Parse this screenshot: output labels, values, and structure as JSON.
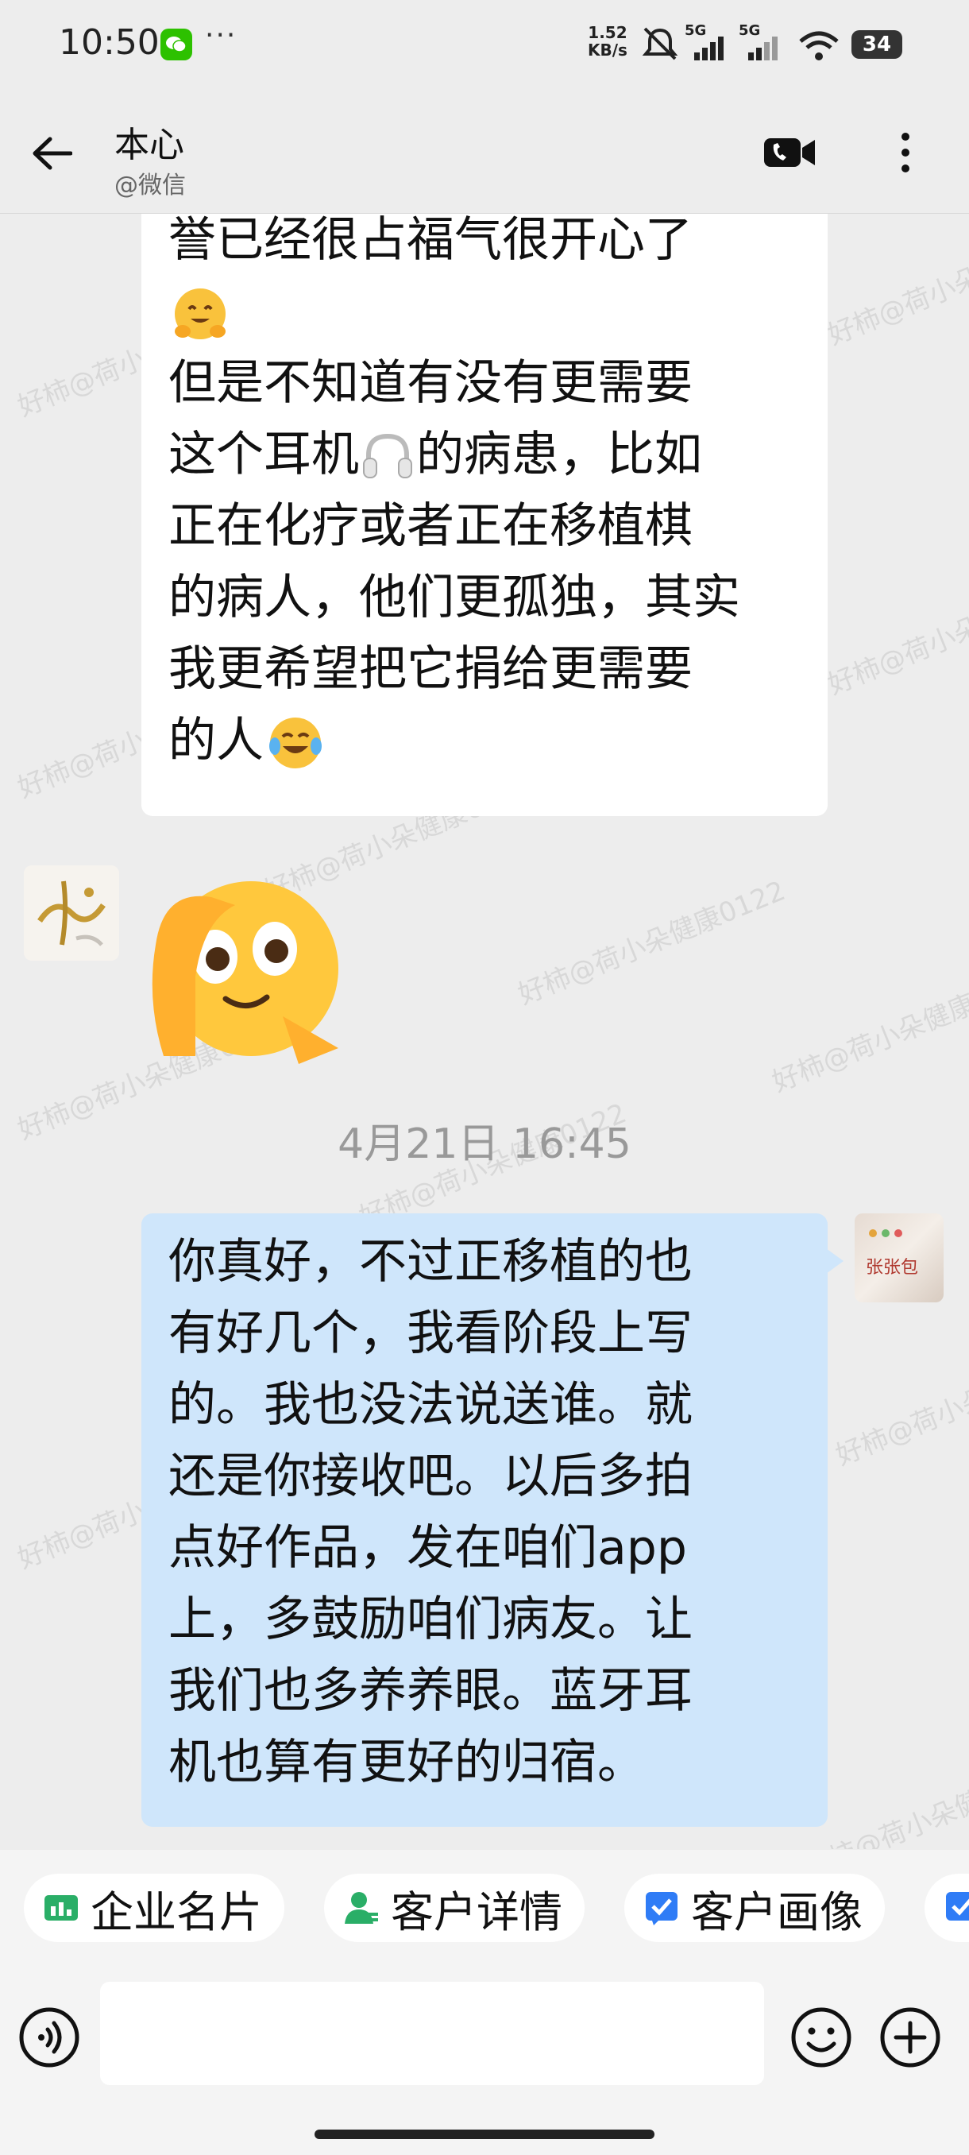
{
  "status_bar": {
    "time": "10:50",
    "more": "···",
    "net_speed_value": "1.52",
    "net_speed_unit": "KB/s",
    "signal_1": "5G",
    "signal_2": "5G",
    "battery": "34"
  },
  "header": {
    "contact_name": "本心",
    "contact_source": "@微信"
  },
  "messages": {
    "msg1_lines": [
      "誉已经很占福气很开心了",
      "但是不知道有没有更需要",
      "这个耳机",
      "的病患，比如",
      "正在化疗或者正在移植棋",
      "的病人，他们更孤独，其实",
      "我更希望把它捐给更需要",
      "的人"
    ],
    "timestamp": "4月21日  16:45",
    "msg2_lines": [
      "你真好，不过正移植的也",
      "有好几个，我看阶段上写",
      "的。我也没法说送谁。就",
      "还是你接收吧。以后多拍",
      "点好作品，发在咱们app",
      "上，多鼓励咱们病友。让",
      "我们也多养养眼。蓝牙耳",
      "机也算有更好的归宿。"
    ],
    "right_avatar_text": "张张包"
  },
  "watermark": "好柿@荷小朵健康0122",
  "quick_tools": [
    {
      "label": "企业名片",
      "icon": "business-card-icon",
      "color": "#2aae67"
    },
    {
      "label": "客户详情",
      "icon": "customer-icon",
      "color": "#2aae67"
    },
    {
      "label": "客户画像",
      "icon": "checkbox-icon",
      "color": "#2f7cf6"
    }
  ],
  "input": {
    "placeholder": ""
  }
}
